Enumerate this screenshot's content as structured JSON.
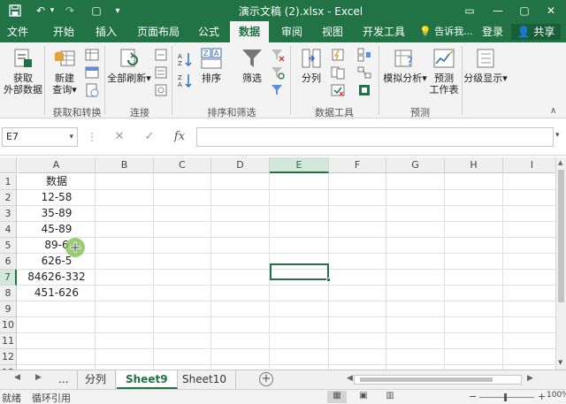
{
  "titlebar": {
    "title": "演示文稿 (2).xlsx - Excel",
    "icons": [
      "save-icon",
      "undo-icon",
      "redo-icon",
      "new-doc-icon",
      "customize-qa-icon",
      "ribbon-display-icon",
      "minimize-icon",
      "restore-icon",
      "close-icon"
    ],
    "glyphs": {
      "undo": "↶",
      "undo_dd": "▾",
      "redo": "↷",
      "new": "▢",
      "customize": "▾",
      "ribbon": "▭",
      "minimize": "—",
      "restore": "▢",
      "close": "✕"
    }
  },
  "tabs": [
    {
      "label": "文件",
      "active": false
    },
    {
      "label": "开始",
      "active": false
    },
    {
      "label": "插入",
      "active": false
    },
    {
      "label": "页面布局",
      "active": false
    },
    {
      "label": "公式",
      "active": false
    },
    {
      "label": "数据",
      "active": true
    },
    {
      "label": "审阅",
      "active": false
    },
    {
      "label": "视图",
      "active": false
    },
    {
      "label": "开发工具",
      "active": false
    }
  ],
  "tellme": {
    "icon": "💡",
    "label": "告诉我..."
  },
  "login": "登录",
  "share": {
    "icon": "👤",
    "label": "共享"
  },
  "ribbon": {
    "buttons": {
      "get_external_1": "获取",
      "get_external_2": "外部数据",
      "new_query_1": "新建",
      "new_query_2": "查询",
      "refresh_all": "全部刷新",
      "sort": "排序",
      "filter": "筛选",
      "split": "分列",
      "what_if": "模拟分析",
      "forecast_1": "预测",
      "forecast_2": "工作表",
      "outline": "分级显示"
    },
    "dropdown_arrow": "▾",
    "collapse_glyph": "∧",
    "groups": [
      "获取和转换",
      "连接",
      "排序和筛选",
      "数据工具",
      "预测"
    ]
  },
  "formula_bar": {
    "name_box": "E7",
    "name_box_dd": "▾",
    "dots": "⋮",
    "cancel": "✕",
    "enter": "✓",
    "fx": "fx",
    "formula": "",
    "expand": "▾"
  },
  "columns": [
    "A",
    "B",
    "C",
    "D",
    "E",
    "F",
    "G",
    "H",
    "I"
  ],
  "selected_column": "E",
  "rows": [
    "1",
    "2",
    "3",
    "4",
    "5",
    "6",
    "7",
    "8",
    "9",
    "10",
    "11",
    "12",
    "13"
  ],
  "selected_row": "7",
  "cells_a": [
    "数据",
    "12-58",
    "35-89",
    "45-89",
    "89-6",
    "626-5",
    "84626-332",
    "451-626"
  ],
  "sheets": [
    {
      "label": "...",
      "active": false
    },
    {
      "label": "分列",
      "active": false
    },
    {
      "label": "Sheet9",
      "active": true
    },
    {
      "label": "Sheet10",
      "active": false
    }
  ],
  "sheet_nav": {
    "prev": "◀",
    "next": "▶",
    "add": "+"
  },
  "scroll_glyphs": {
    "up": "▲",
    "down": "▼"
  },
  "status": {
    "ready": "就绪",
    "circular": "循环引用",
    "zoom_minus": "−",
    "zoom_plus": "+",
    "zoom": "100%",
    "view_icons": {
      "normal": "▦",
      "layout": "▣",
      "pagebreak": "▥"
    }
  },
  "colors": {
    "accent": "#217346",
    "ribbon_bg": "#f3f3f3"
  }
}
